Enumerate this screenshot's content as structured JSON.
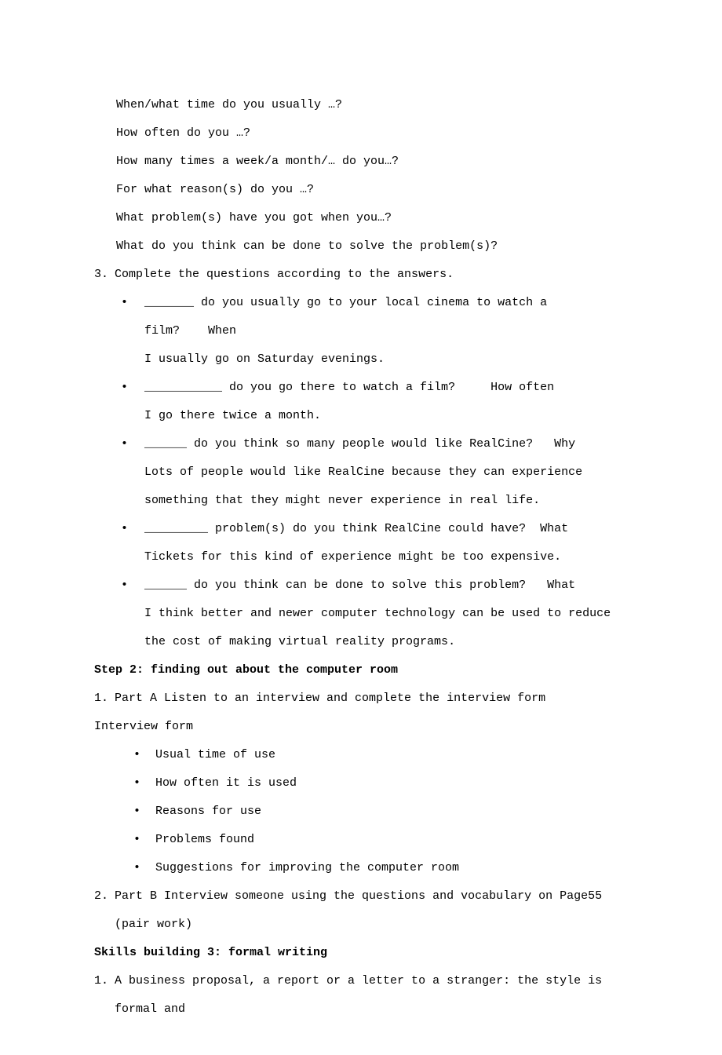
{
  "lines": {
    "q1": "When/what time do you usually …?",
    "q2": "How often do you …?",
    "q3": "How many times a week/a month/… do you…?",
    "q4": "For what reason(s) do you …?",
    "q5": "What problem(s) have you got when you…?",
    "q6": "What do you think can be done to solve the problem(s)?"
  },
  "item3": {
    "num": "3.",
    "text": "Complete the questions according to the answers."
  },
  "b1": {
    "line1a": "_______ do you usually go to your local cinema to watch a film?",
    "line1b": "When",
    "line2": "I usually go on Saturday evenings."
  },
  "b2": {
    "line1a": "___________ do you go there to watch a film?",
    "line1b": "How often",
    "line2": "I go there twice a month."
  },
  "b3": {
    "line1a": "______ do you think so many people would like RealCine?",
    "line1b": "Why",
    "line2": "Lots of people would like RealCine because they can experience something that they might never experience in real life."
  },
  "b4": {
    "line1a": "_________ problem(s) do you think RealCine could have?",
    "line1b": "What",
    "line2": "Tickets for this kind of experience might be too expensive."
  },
  "b5": {
    "line1a": "______ do you think can be done to solve this problem?",
    "line1b": "What",
    "line2": "I think better and newer computer technology can be used to reduce the cost of making virtual reality programs."
  },
  "step2": "Step 2: finding out about the computer room",
  "partA": {
    "num": "1.",
    "text": "Part A Listen to an interview and complete the interview form"
  },
  "interviewForm": "Interview form",
  "formItems": [
    "Usual time of use",
    "How often it is used",
    "Reasons for use",
    "Problems found",
    "Suggestions for improving the computer room"
  ],
  "partB": {
    "num": "2.",
    "text": "Part B Interview someone using the questions and vocabulary on Page55 (pair work)"
  },
  "skills3": "Skills building 3: formal writing",
  "skills3item": {
    "num": "1.",
    "text": "A business proposal, a report or a letter to a stranger: the style is formal and"
  }
}
